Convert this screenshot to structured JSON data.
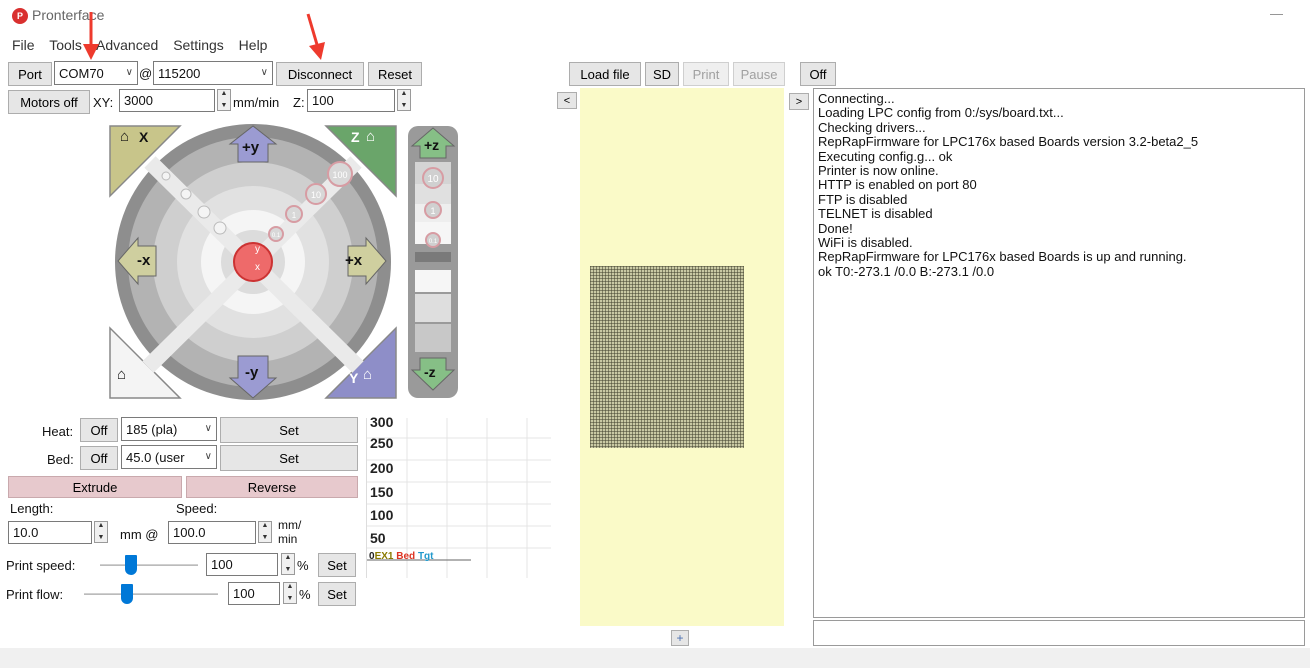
{
  "titlebar": {
    "title": "Pronterface",
    "minimize": "—"
  },
  "menu": [
    "File",
    "Tools",
    "Advanced",
    "Settings",
    "Help"
  ],
  "connection": {
    "port_button": "Port",
    "port_value": "COM70",
    "at": "@",
    "baud_value": "115200",
    "disconnect": "Disconnect",
    "reset": "Reset"
  },
  "motors": {
    "motors_off": "Motors off",
    "xy_label": "XY:",
    "xy_value": "3000",
    "units": "mm/min",
    "z_label": "Z:",
    "z_value": "100"
  },
  "jog": {
    "home_x": "X",
    "home_z": "Z",
    "home_y": "Y",
    "plus_y": "+y",
    "minus_y": "-y",
    "plus_x": "+x",
    "minus_x": "-x",
    "plus_z": "+z",
    "minus_z": "-z",
    "steps": [
      "100",
      "10",
      "1",
      "0.1"
    ],
    "z_steps": [
      "10",
      "1",
      "0.1"
    ],
    "center_y": "y",
    "center_x": "x"
  },
  "temps": {
    "heat_label": "Heat:",
    "heat_off": "Off",
    "heat_value": "185 (pla)",
    "heat_set": "Set",
    "bed_label": "Bed:",
    "bed_off": "Off",
    "bed_value": "45.0 (user",
    "bed_set": "Set"
  },
  "extrude": {
    "extrude": "Extrude",
    "reverse": "Reverse",
    "length_label": "Length:",
    "speed_label": "Speed:",
    "length_value": "10.0",
    "mm_at": "mm @",
    "speed_value": "100.0",
    "speed_units_1": "mm/",
    "speed_units_2": "min"
  },
  "print_speed": {
    "label": "Print speed:",
    "value": "100",
    "pct": "%",
    "set": "Set",
    "level": 0.32
  },
  "print_flow": {
    "label": "Print flow:",
    "value": "100",
    "pct": "%",
    "set": "Set",
    "level": 0.32
  },
  "graph": {
    "ticks": [
      "300",
      "250",
      "200",
      "150",
      "100",
      "50"
    ],
    "legend_ex": "EX1",
    "legend_bed": "Bed",
    "legend_tgt": "Tgt",
    "legend_prefix": "0"
  },
  "file_controls": {
    "load_file": "Load file",
    "sd": "SD",
    "print": "Print",
    "pause": "Pause",
    "off": "Off",
    "collapse_left": "<",
    "collapse_right": ">",
    "add": "+"
  },
  "log": [
    "Connecting...",
    "Loading LPC config from 0:/sys/board.txt...",
    "Checking drivers...",
    "RepRapFirmware for LPC176x based Boards version 3.2-beta2_5",
    "Executing config.g... ok",
    "Printer is now online.",
    "HTTP is enabled on port 80",
    "FTP is disabled",
    "TELNET is disabled",
    "Done!",
    "WiFi is disabled.",
    "RepRapFirmware for LPC176x based Boards is up and running.",
    "ok T0:-273.1 /0.0 B:-273.1 /0.0"
  ],
  "colors": {
    "plate": "#fafac8",
    "arrow": "#ee3a2d",
    "home_x": "#c8c58a",
    "home_z": "#6aa56a",
    "home_y": "#8e8ec8",
    "jog_blue": "#9b9bd2",
    "jog_olive": "#cfcf9f",
    "jog_green": "#86bf86"
  }
}
